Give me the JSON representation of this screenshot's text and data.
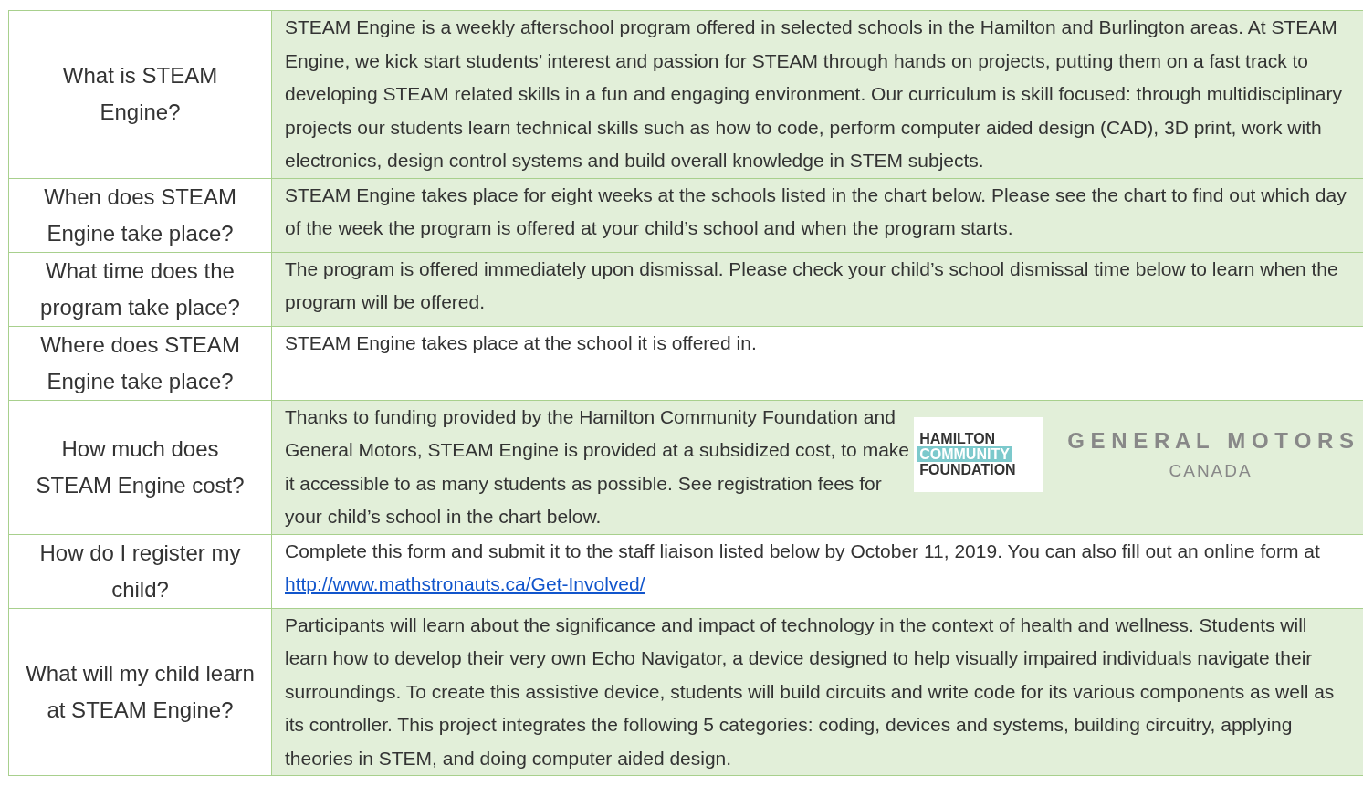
{
  "rows": [
    {
      "question": "What is STEAM Engine?",
      "shaded": true,
      "answer": "STEAM Engine is a weekly afterschool program offered in selected schools in the Hamilton and Burlington areas. At STEAM Engine, we kick start students’ interest and passion for STEAM through hands on projects, putting them on a fast track to developing STEAM related skills in a fun and engaging environment. Our curriculum is skill focused: through multidisciplinary projects our students learn technical skills such as how to code, perform computer aided design (CAD), 3D print, work with electronics, design control systems and build overall knowledge in STEM subjects."
    },
    {
      "question": "When does STEAM Engine take place?",
      "shaded": true,
      "answer": "STEAM Engine takes place for eight weeks at the schools listed in the chart below. Please see the chart to find out which day of the week the program is offered at your child’s school and when the program starts."
    },
    {
      "question": "What time does the program take place?",
      "shaded": true,
      "answer": "The program is offered immediately upon dismissal. Please check your child’s school dismissal time below to learn when the program will be offered."
    },
    {
      "question": "Where does STEAM Engine take place?",
      "shaded": false,
      "answer": "STEAM Engine takes place at the school it is offered in."
    },
    {
      "question": "How much does STEAM Engine cost?",
      "shaded": true,
      "answer": "Thanks to funding provided by the Hamilton Community Foundation and General Motors, STEAM Engine is provided at a subsidized cost, to make it accessible to as many students as possible. See registration fees for your child’s school in the chart below.",
      "logos": {
        "foundation": [
          "HAMILTON",
          "COMMUNITY",
          "FOUNDATION"
        ],
        "motors": "G E N E R A L   M O T O R S",
        "motors_sub": "CANADA"
      }
    },
    {
      "question": "How do I register my child?",
      "shaded": false,
      "answer": "Complete this form and submit it to the staff liaison listed below by October 11, 2019. You can also fill out an online form at",
      "link": "http://www.mathstronauts.ca/Get-Involved/"
    },
    {
      "question": "What will my child learn at STEAM Engine?",
      "shaded": true,
      "answer": "Participants will learn about the significance and impact of technology in the context of health and wellness. Students will learn how to develop their very own Echo Navigator, a device designed to help visually impaired individuals navigate their surroundings. To create this assistive device, students will build circuits and write code for its various components as well as its controller. This project integrates the following 5 categories: coding, devices and systems, building circuitry, applying theories in STEM, and doing computer aided design."
    }
  ]
}
